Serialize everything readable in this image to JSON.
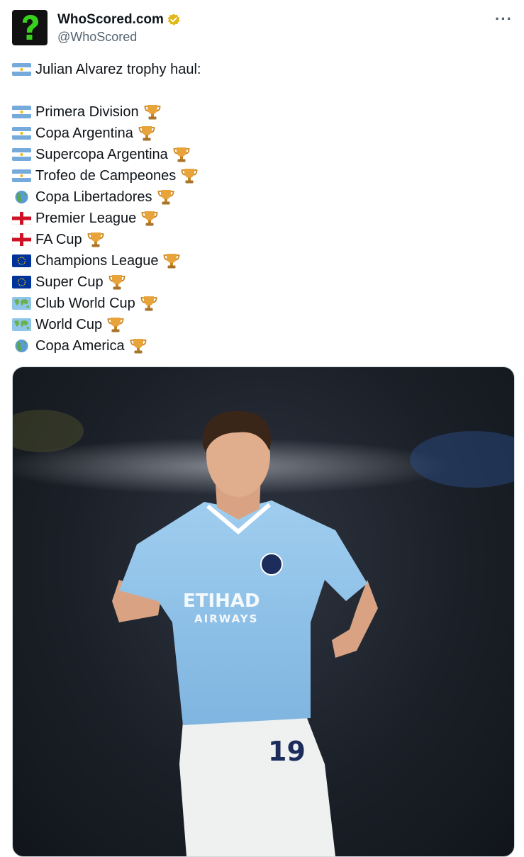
{
  "account": {
    "display_name": "WhoScored.com",
    "handle": "@WhoScored",
    "avatar_icon": "green-question-mark-icon",
    "verified_icon": "verified-badge-icon",
    "verified_color": "#e2b719"
  },
  "menu": {
    "more_label": "···"
  },
  "tweet": {
    "intro": "Julian Alvarez trophy haul:",
    "intro_flag": "argentina-flag-icon",
    "trophy_icon": "trophy-icon",
    "trophies": [
      {
        "label": "Primera Division",
        "flag": "argentina-flag-icon"
      },
      {
        "label": "Copa Argentina",
        "flag": "argentina-flag-icon"
      },
      {
        "label": "Supercopa Argentina",
        "flag": "argentina-flag-icon"
      },
      {
        "label": "Trofeo de Campeones",
        "flag": "argentina-flag-icon"
      },
      {
        "label": "Copa Libertadores",
        "flag": "globe-americas-icon"
      },
      {
        "label": "Premier League",
        "flag": "england-flag-icon"
      },
      {
        "label": "FA Cup",
        "flag": "england-flag-icon"
      },
      {
        "label": "Champions League",
        "flag": "eu-flag-icon"
      },
      {
        "label": "Super Cup",
        "flag": "eu-flag-icon"
      },
      {
        "label": "Club World Cup",
        "flag": "world-map-icon"
      },
      {
        "label": "World Cup",
        "flag": "world-map-icon"
      },
      {
        "label": "Copa America",
        "flag": "globe-americas-icon"
      }
    ]
  },
  "media": {
    "kind": "photo",
    "shirt_sponsor_line1": "ETIHAD",
    "shirt_sponsor_line2": "AIRWAYS",
    "shirt_number": "19",
    "kit_color": "#8fc3ea"
  }
}
